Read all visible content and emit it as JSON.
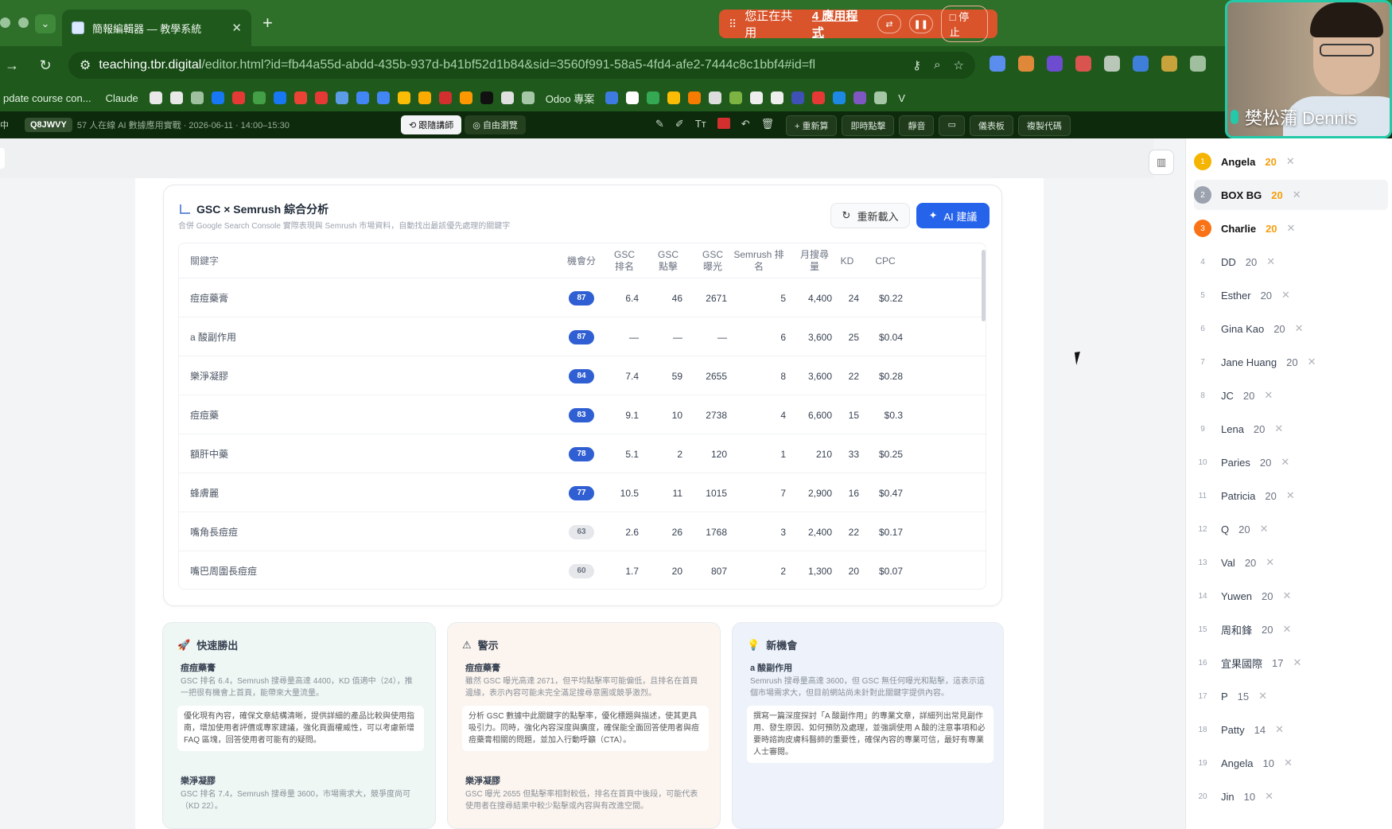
{
  "browser": {
    "tab_title": "簡報編輯器 — 教學系統",
    "url_host": "teaching.tbr.digital",
    "url_path": "/editor.html?id=fb44a55d-abdd-435b-937d-b41bf52d1b84&sid=3560f991-58a5-4fd4-afe2-7444c8c1bbf4#id=fb44a55d-...",
    "share_text": "您正在共用",
    "share_app": "4 應用程式",
    "share_stop": "停止",
    "bookmarks": [
      "pdate course con...",
      "Claude",
      "Odoo 專案",
      "V"
    ]
  },
  "app_toolbar": {
    "lang": "中",
    "room_code": "Q8JWVY",
    "meta": "57 人在線 AI 數據應用實戰 · 2026-06-11 · 14:00–15:30",
    "modes": [
      "跟隨講師",
      "自由瀏覽"
    ],
    "tools": [
      "+ 重新算",
      "即時點擊",
      "靜音",
      "儀表板",
      "複製代碼"
    ]
  },
  "card": {
    "title": "GSC × Semrush 綜合分析",
    "subtitle": "合併 Google Search Console 實際表現與 Semrush 市場資料，自動找出最該優先處理的關鍵字",
    "reload_label": "重新載入",
    "ai_label": "AI 建議",
    "headers": [
      "關鍵字",
      "機會分",
      "GSC 排名",
      "GSC 點擊",
      "GSC 曝光",
      "Semrush 排名",
      "月搜尋量",
      "KD",
      "CPC"
    ],
    "rows": [
      {
        "kw": "痘痘藥膏",
        "score": "87",
        "hl": true,
        "rank": "6.4",
        "clicks": "46",
        "impr": "2671",
        "sem": "5",
        "vol": "4,400",
        "kd": "24",
        "cpc": "$0.22"
      },
      {
        "kw": "a 酸副作用",
        "score": "87",
        "hl": true,
        "rank": "—",
        "clicks": "—",
        "impr": "—",
        "sem": "6",
        "vol": "3,600",
        "kd": "25",
        "cpc": "$0.04"
      },
      {
        "kw": "樂淨凝膠",
        "score": "84",
        "hl": true,
        "rank": "7.4",
        "clicks": "59",
        "impr": "2655",
        "sem": "8",
        "vol": "3,600",
        "kd": "22",
        "cpc": "$0.28"
      },
      {
        "kw": "痘痘藥",
        "score": "83",
        "hl": true,
        "rank": "9.1",
        "clicks": "10",
        "impr": "2738",
        "sem": "4",
        "vol": "6,600",
        "kd": "15",
        "cpc": "$0.3"
      },
      {
        "kw": "額肝中藥",
        "score": "78",
        "hl": true,
        "rank": "5.1",
        "clicks": "2",
        "impr": "120",
        "sem": "1",
        "vol": "210",
        "kd": "33",
        "cpc": "$0.25"
      },
      {
        "kw": "蜂膚麗",
        "score": "77",
        "hl": true,
        "rank": "10.5",
        "clicks": "11",
        "impr": "1015",
        "sem": "7",
        "vol": "2,900",
        "kd": "16",
        "cpc": "$0.47"
      },
      {
        "kw": "嘴角長痘痘",
        "score": "63",
        "hl": false,
        "rank": "2.6",
        "clicks": "26",
        "impr": "1768",
        "sem": "3",
        "vol": "2,400",
        "kd": "22",
        "cpc": "$0.17"
      },
      {
        "kw": "嘴巴周圍長痘痘",
        "score": "60",
        "hl": false,
        "rank": "1.7",
        "clicks": "20",
        "impr": "807",
        "sem": "2",
        "vol": "1,300",
        "kd": "20",
        "cpc": "$0.07"
      }
    ]
  },
  "panels": [
    {
      "title": "快速勝出",
      "icon": "🚀",
      "kw1": "痘痘藥膏",
      "desc1": "GSC 排名 6.4，Semrush 搜尋量高達 4400，KD 值適中（24），推一把很有機會上首頁，能帶來大量流量。",
      "box1": "優化現有內容，確保文章結構清晰，提供詳細的產品比較與使用指南，增加使用者評價或專家建議，強化頁面權威性，可以考慮新增 FAQ 區塊，回答使用者可能有的疑問。",
      "kw2": "樂淨凝膠",
      "desc2": "GSC 排名 7.4，Semrush 搜尋量 3600，市場需求大，競爭度尚可（KD 22）。"
    },
    {
      "title": "警示",
      "icon": "⚠",
      "kw1": "痘痘藥膏",
      "desc1": "雖然 GSC 曝光高達 2671，但平均點擊率可能偏低，且排名在首頁邊緣，表示內容可能未完全滿足搜尋意圖或競爭激烈。",
      "box1": "分析 GSC 數據中此關鍵字的點擊率，優化標題與描述，使其更具吸引力。同時，強化內容深度與廣度，確保能全面回答使用者與痘痘藥膏相關的問題，並加入行動呼籲（CTA）。",
      "kw2": "樂淨凝膠",
      "desc2": "GSC 曝光 2655 但點擊率相對較低，排名在首頁中後段，可能代表使用者在搜尋結果中較少點擊或內容與有改進空間。"
    },
    {
      "title": "新機會",
      "icon": "💡",
      "kw1": "a 酸副作用",
      "desc1": "Semrush 搜尋量高達 3600，但 GSC 無任何曝光和點擊，這表示這個市場需求大，但目前網站尚未針對此關鍵字提供內容。",
      "box1": "撰寫一篇深度探討「A 酸副作用」的專業文章，詳細列出常見副作用、發生原因、如何預防及處理，並強調使用 A 酸的注意事項和必要時諮詢皮膚科醫師的重要性，確保內容的專業可信，最好有專業人士審閱。",
      "kw2": "",
      "desc2": ""
    }
  ],
  "leaderboard": [
    {
      "rank": "1",
      "name": "Angela",
      "score": "20"
    },
    {
      "rank": "2",
      "name": "BOX BG",
      "score": "20"
    },
    {
      "rank": "3",
      "name": "Charlie",
      "score": "20"
    },
    {
      "rank": "4",
      "name": "DD",
      "score": "20"
    },
    {
      "rank": "5",
      "name": "Esther",
      "score": "20"
    },
    {
      "rank": "6",
      "name": "Gina Kao",
      "score": "20"
    },
    {
      "rank": "7",
      "name": "Jane Huang",
      "score": "20"
    },
    {
      "rank": "8",
      "name": "JC",
      "score": "20"
    },
    {
      "rank": "9",
      "name": "Lena",
      "score": "20"
    },
    {
      "rank": "10",
      "name": "Paries",
      "score": "20"
    },
    {
      "rank": "11",
      "name": "Patricia",
      "score": "20"
    },
    {
      "rank": "12",
      "name": "Q",
      "score": "20"
    },
    {
      "rank": "13",
      "name": "Val",
      "score": "20"
    },
    {
      "rank": "14",
      "name": "Yuwen",
      "score": "20"
    },
    {
      "rank": "15",
      "name": "周和鋒",
      "score": "20"
    },
    {
      "rank": "16",
      "name": "宜果國際",
      "score": "17"
    },
    {
      "rank": "17",
      "name": "P",
      "score": "15"
    },
    {
      "rank": "18",
      "name": "Patty",
      "score": "14"
    },
    {
      "rank": "19",
      "name": "Angela",
      "score": "10"
    },
    {
      "rank": "20",
      "name": "Jin",
      "score": "10"
    }
  ],
  "webcam": {
    "name": "樊松蒲 Dennis"
  },
  "colors": {
    "accent": "#2563eb",
    "share_banner": "#d9542b",
    "browser_green": "#1f5a1c",
    "gold": "#f5b400"
  }
}
